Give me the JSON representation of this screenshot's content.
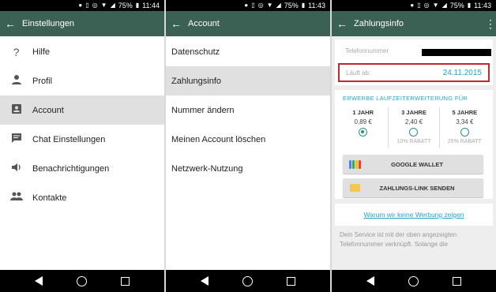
{
  "status_left": {
    "battery": "75%",
    "time": "11:44"
  },
  "status_mid": {
    "battery": "75%",
    "time": "11:43"
  },
  "status_right": {
    "battery": "75%",
    "time": "11:43"
  },
  "settings_screen": {
    "title": "Einstellungen",
    "items": [
      {
        "label": "Hilfe",
        "icon": "help-icon"
      },
      {
        "label": "Profil",
        "icon": "person-icon"
      },
      {
        "label": "Account",
        "icon": "account-box-icon",
        "selected": true
      },
      {
        "label": "Chat Einstellungen",
        "icon": "chat-icon"
      },
      {
        "label": "Benachrichtigungen",
        "icon": "volume-icon"
      },
      {
        "label": "Kontakte",
        "icon": "group-icon"
      }
    ]
  },
  "account_screen": {
    "title": "Account",
    "items": [
      {
        "label": "Datenschutz"
      },
      {
        "label": "Zahlungsinfo",
        "selected": true
      },
      {
        "label": "Nummer ändern"
      },
      {
        "label": "Meinen Account löschen"
      },
      {
        "label": "Netzwerk-Nutzung"
      }
    ]
  },
  "payment_screen": {
    "title": "Zahlungsinfo",
    "phone_label": "Telefonnummer",
    "expiry_label": "Läuft ab:",
    "expiry_date": "24.11.2015",
    "extend_title": "ERWERBE LAUFZEITERWEITERUNG FÜR",
    "plans": [
      {
        "name": "1 JAHR",
        "price": "0,89 €",
        "discount": "",
        "checked": true
      },
      {
        "name": "3 JAHRE",
        "price": "2,40 €",
        "discount": "10% RABATT",
        "checked": false
      },
      {
        "name": "5 JAHRE",
        "price": "3,34 €",
        "discount": "25% RABATT",
        "checked": false
      }
    ],
    "google_wallet_label": "GOOGLE WALLET",
    "payment_link_label": "ZAHLUNGS-LINK SENDEN",
    "no_ads_link": "Warum wir keine Werbung zeigen",
    "footnote": "Dein Service ist mit der oben angezeigten Telefonnummer verknüpft. Solange die"
  },
  "colors": {
    "appbar": "#3b6155",
    "accent": "#26a4c6",
    "highlight_border": "#c62828",
    "radio": "#2e8f88"
  }
}
